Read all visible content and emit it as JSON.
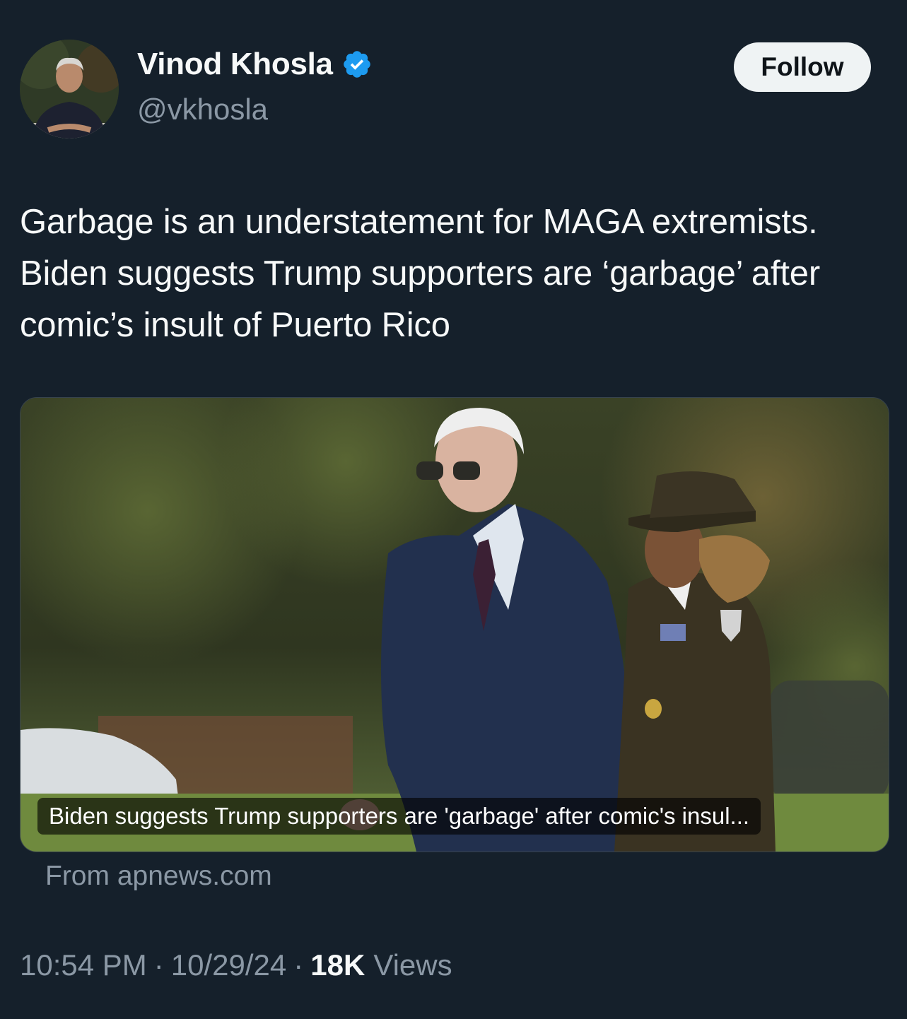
{
  "author": {
    "display_name": "Vinod Khosla",
    "handle": "@vkhosla",
    "verified": true,
    "verified_color": "#1d9bf0",
    "avatar_icon": "profile-photo"
  },
  "follow_button": {
    "label": "Follow"
  },
  "tweet": {
    "text": "Garbage is an understatement for MAGA extremists. Biden suggests Trump supporters are ‘garbage’ after comic’s insult of Puerto Rico"
  },
  "link_card": {
    "caption": "Biden suggests Trump supporters are 'garbage' after comic's insul...",
    "source": "From apnews.com"
  },
  "meta": {
    "time": "10:54 PM",
    "separator": "·",
    "date": "10/29/24",
    "views_count": "18K",
    "views_label": "Views"
  },
  "colors": {
    "background": "#15202b",
    "text_primary": "#f7f9f9",
    "text_secondary": "#8b98a5",
    "follow_bg": "#eff3f4"
  }
}
